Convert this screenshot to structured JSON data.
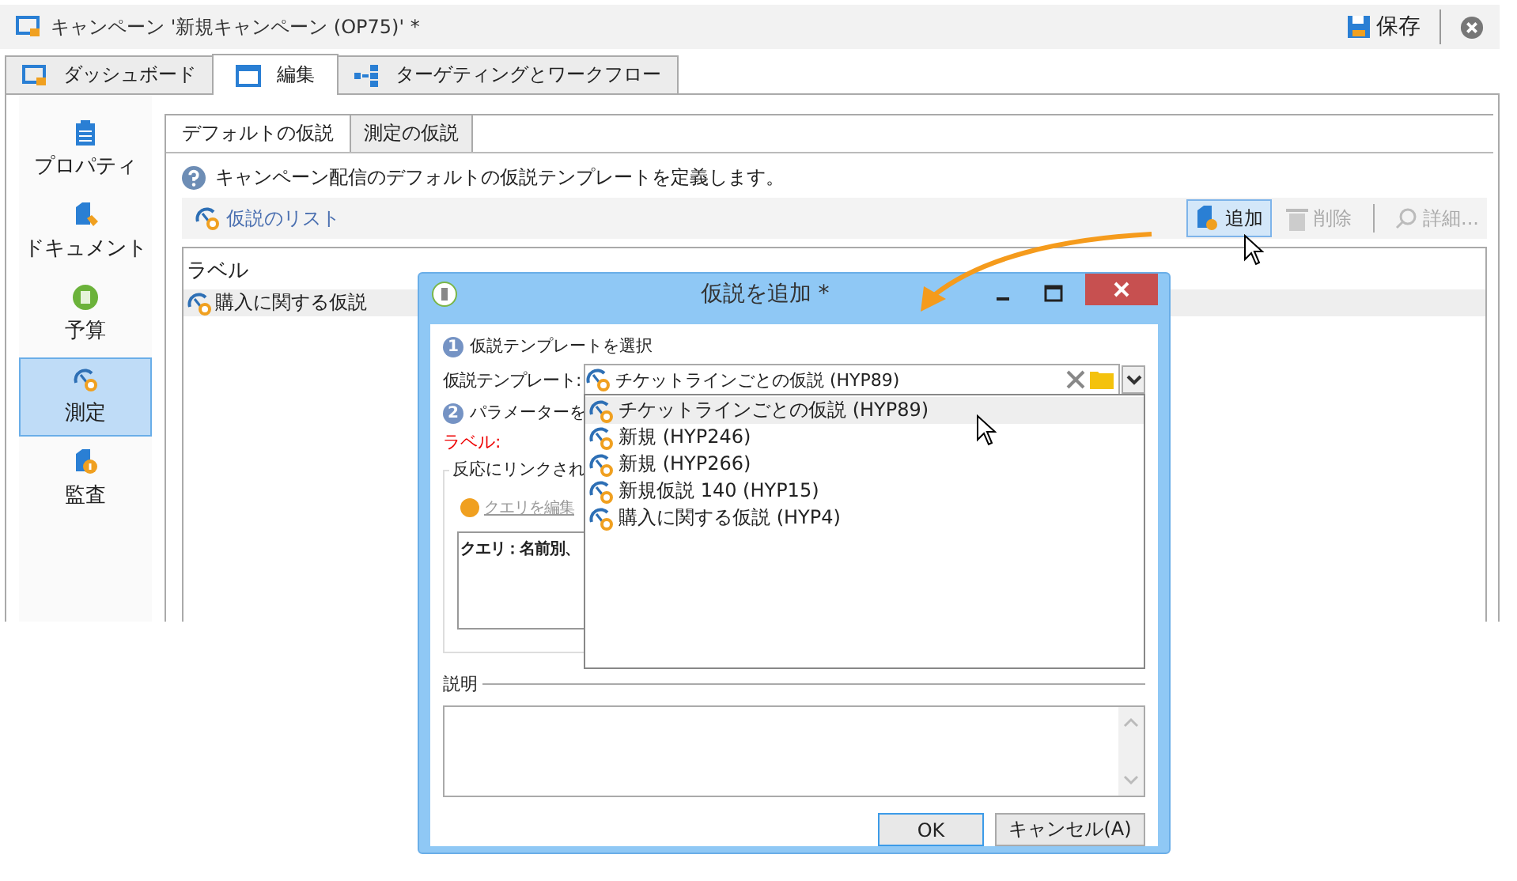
{
  "window": {
    "title": "キャンペーン '新規キャンペーン (OP75)' *",
    "save_button": "保存"
  },
  "tabs": [
    {
      "label": "ダッシュボード",
      "selected": false
    },
    {
      "label": "編集",
      "selected": true
    },
    {
      "label": "ターゲティングとワークフロー",
      "selected": false
    }
  ],
  "sidebar": {
    "items": [
      {
        "label": "プロパティ",
        "selected": false
      },
      {
        "label": "ドキュメント",
        "selected": false
      },
      {
        "label": "予算",
        "selected": false
      },
      {
        "label": "測定",
        "selected": true
      },
      {
        "label": "監査",
        "selected": false
      }
    ]
  },
  "subtabs": [
    {
      "label": "デフォルトの仮説",
      "selected": true
    },
    {
      "label": "測定の仮説",
      "selected": false
    }
  ],
  "info": "キャンペーン配信のデフォルトの仮説テンプレートを定義します。",
  "toolbar": {
    "title": "仮説のリスト",
    "buttons": [
      {
        "label": "追加",
        "disabled": false,
        "hovered": true
      },
      {
        "label": "削除",
        "disabled": true,
        "hovered": false
      },
      {
        "label": "詳細...",
        "disabled": true,
        "hovered": false
      }
    ]
  },
  "list": {
    "columns": [
      "ラベル"
    ],
    "rows": [
      {
        "label": "購入に関する仮説",
        "selected": true
      }
    ]
  },
  "dialog": {
    "title": "仮説を追加 *",
    "step_1": {
      "number": "1",
      "label": "仮説テンプレートを選択"
    },
    "template": {
      "label": "仮説テンプレート:",
      "value": "チケットラインごとの仮説 (HYP89)"
    },
    "step_2": {
      "number": "2",
      "label": "パラメーターを"
    },
    "label_field": "ラベル:",
    "group": {
      "title": "反応にリンクされ",
      "link": "クエリを編集",
      "query": "クエリ：名前別、"
    },
    "description_label": "説明",
    "buttons": [
      {
        "label": "OK",
        "focused": true
      },
      {
        "label": "キャンセル(A)",
        "focused": false
      }
    ],
    "dropdown": [
      {
        "label": "チケットラインごとの仮説 (HYP89)",
        "selected": true
      },
      {
        "label": "新規 (HYP246)",
        "selected": false
      },
      {
        "label": "新規 (HYP266)",
        "selected": false
      },
      {
        "label": "新規仮説  140 (HYP15)",
        "selected": false
      },
      {
        "label": "購入に関する仮説 (HYP4)",
        "selected": false
      }
    ]
  }
}
